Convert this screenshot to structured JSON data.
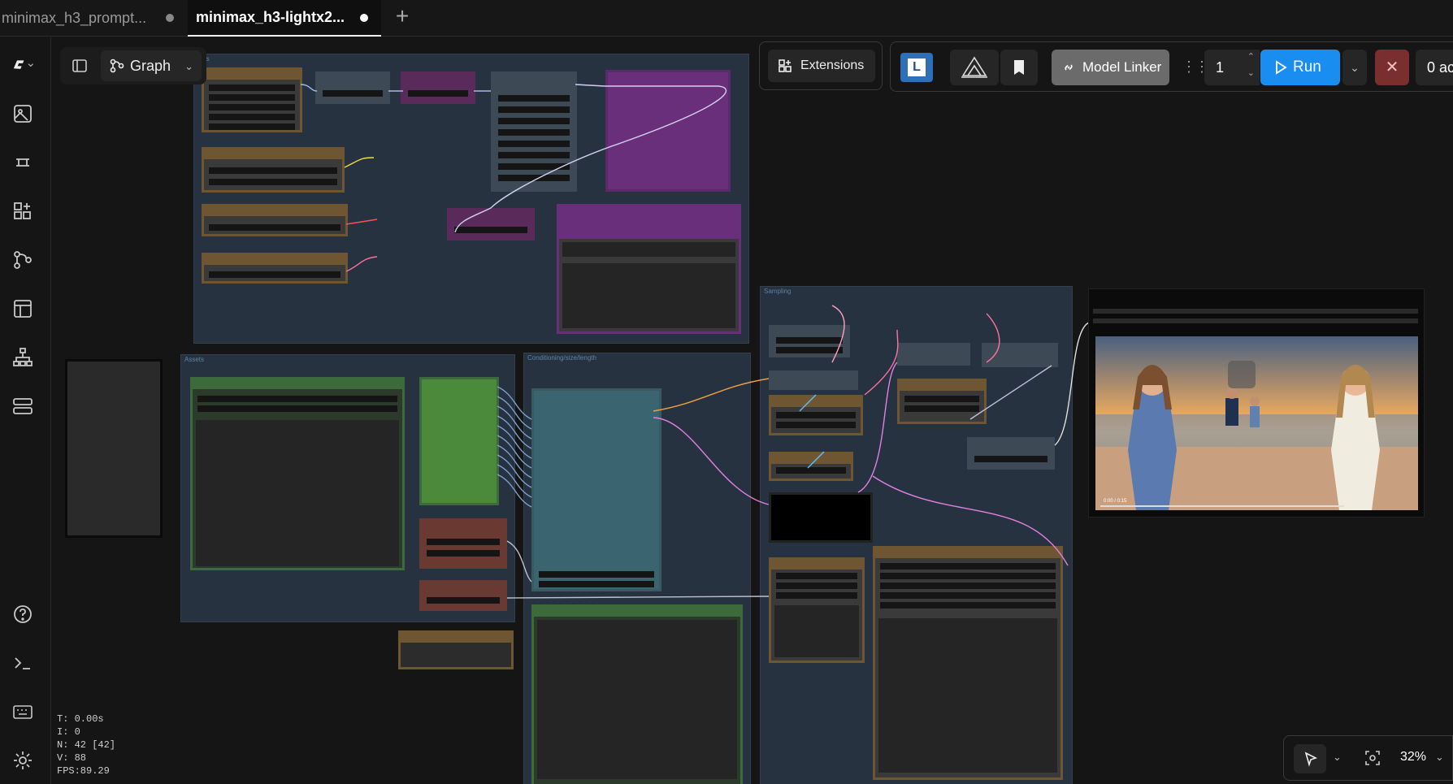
{
  "tabs": [
    {
      "label": "minimax_h3_prompt...",
      "active": false
    },
    {
      "label": "minimax_h3-lightx2...",
      "active": true
    }
  ],
  "toolbar": {
    "graph_label": "Graph",
    "extensions_label": "Extensions",
    "l_button": "L",
    "model_linker_label": "Model Linker",
    "queue_count": "1",
    "run_label": "Run",
    "queue_status": "0 ac"
  },
  "sidebar_icons": [
    "comfy-logo-icon",
    "images-icon",
    "models-icon",
    "nodes-icon",
    "workflows-icon",
    "templates-icon",
    "nodes-map-icon",
    "queue-icon",
    "help-icon",
    "terminal-icon",
    "keyboard-icon",
    "settings-icon"
  ],
  "groups": [
    {
      "id": "models",
      "label": "dels"
    },
    {
      "id": "assets",
      "label": "Assets"
    },
    {
      "id": "cond",
      "label": "Conditioning/size/length"
    },
    {
      "id": "sampling",
      "label": "Sampling"
    }
  ],
  "stats": {
    "t": "T: 0.00s",
    "i": "I: 0",
    "n": "N: 42 [42]",
    "v": "V: 88",
    "fps": "FPS:89.29"
  },
  "zoom": "32%",
  "video": {
    "time": "0:00 / 0:15"
  },
  "colors": {
    "run": "#1a8ef0",
    "stop": "#7a2f2f",
    "model_linker": "#6b6b6b",
    "group": "#263240"
  }
}
